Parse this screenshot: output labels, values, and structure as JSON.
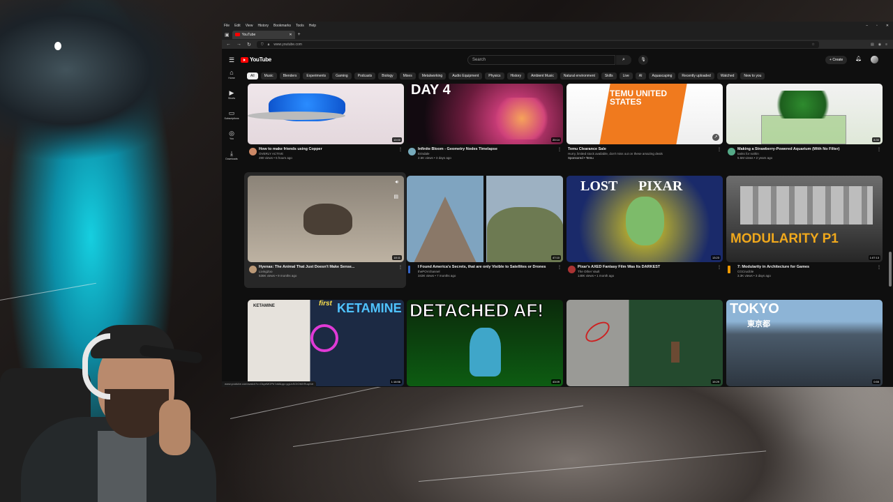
{
  "browser": {
    "menu": [
      "File",
      "Edit",
      "View",
      "History",
      "Bookmarks",
      "Tools",
      "Help"
    ],
    "tab_title": "YouTube",
    "url": "www.youtube.com",
    "status_url": "www.youtube.com/watch?v=GkyeMOPb7aM&pp=ygUcSOIOMXRuqXdr"
  },
  "header": {
    "search_placeholder": "Search",
    "create_label": "Create"
  },
  "rail": [
    {
      "label": "Home",
      "icon": "home-icon"
    },
    {
      "label": "Shorts",
      "icon": "shorts-icon"
    },
    {
      "label": "Subscriptions",
      "icon": "subscriptions-icon"
    },
    {
      "label": "You",
      "icon": "you-icon"
    },
    {
      "label": "Downloads",
      "icon": "downloads-icon"
    }
  ],
  "chips": [
    "All",
    "Music",
    "Blenders",
    "Experiments",
    "Gaming",
    "Podcasts",
    "Biology",
    "Mixes",
    "Metalworking",
    "Audio Equipment",
    "Physics",
    "History",
    "Ambient Music",
    "Natural environment",
    "Skills",
    "Live",
    "AI",
    "Aquascaping",
    "Recently uploaded",
    "Watched",
    "New to you"
  ],
  "videos": [
    {
      "title": "How to make friends using Copper",
      "channel": "OVERLY ACTIVE",
      "stats": "280 views • 5 hours ago",
      "duration": "10:00"
    },
    {
      "title": "Infinite Bloom - Geometry Nodes Timelapse",
      "channel": "Erindale",
      "stats": "2.6K views • 3 days ago",
      "duration": "20:14"
    },
    {
      "title": "Temu Clearance Sale",
      "channel": "Hurry, limited stock available, don't miss out on these amazing deals",
      "stats": "Sponsored • Temu",
      "duration": "",
      "thumb_text": "TEMU UNITED STATES"
    },
    {
      "title": "Making a Strawberry-Powered Aquarium (With No Filter)",
      "channel": "tanks for nothin",
      "stats": "5.5M views • 2 years ago",
      "duration": "8:30"
    },
    {
      "title": "Hyenas: The Animal That Just Doesn't Make Sense...",
      "channel": "LivingZoo",
      "stats": "536K views • 9 months ago",
      "duration": "18:11"
    },
    {
      "title": "I Found America's Secrets, that are only Visible to Satellites or Drones",
      "channel": "thePOVchannel",
      "stats": "343K views • 7 months ago",
      "duration": "47:10"
    },
    {
      "title": "Pixar's AXED Fantasy Film Was Its DARKEST",
      "channel": "The Other Vault",
      "stats": "148K views • 1 month ago",
      "duration": "13:23",
      "thumb_text": "LOST PIXAR"
    },
    {
      "title": "7: Modularity in Architecture for Games",
      "channel": "CGCrucible",
      "stats": "3.3K views • 3 days ago",
      "duration": "1:07:13",
      "thumb_text": "MODULARITY P1"
    },
    {
      "title": "",
      "channel": "",
      "stats": "",
      "duration": "1:16:56",
      "thumb_text": "KETAMINE"
    },
    {
      "title": "",
      "channel": "",
      "stats": "",
      "duration": "43:09",
      "thumb_text": "DETACHED AF!"
    },
    {
      "title": "",
      "channel": "",
      "stats": "",
      "duration": "19:29"
    },
    {
      "title": "",
      "channel": "",
      "stats": "",
      "duration": "0:55",
      "thumb_text": "TOKYO"
    }
  ],
  "thumb_extra": {
    "day": "DAY 4",
    "tokyo_jp": "東京都",
    "ketamine_small": "KETAMINE",
    "first": "first"
  }
}
